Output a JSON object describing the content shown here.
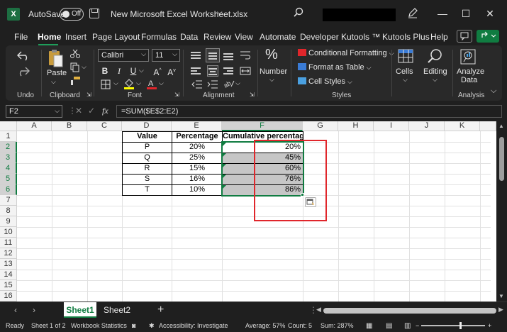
{
  "titlebar": {
    "app_icon": "X",
    "autosave_label": "AutoSave",
    "autosave_state": "Off",
    "document_title": "New Microsoft Excel Worksheet.xlsx",
    "icons": [
      "excel-logo-icon",
      "save-icon",
      "chevron-down-icon",
      "search-icon",
      "pen-icon",
      "minimize-icon",
      "maximize-icon",
      "close-icon"
    ]
  },
  "menu": {
    "tabs": [
      "File",
      "Home",
      "Insert",
      "Page Layout",
      "Formulas",
      "Data",
      "Review",
      "View",
      "Automate",
      "Developer",
      "Kutools ™",
      "Kutools Plus",
      "Help"
    ],
    "active": "Home"
  },
  "ribbon": {
    "undo_group": "Undo",
    "clipboard_group": "Clipboard",
    "paste_label": "Paste",
    "font_group": "Font",
    "font_name": "Calibri",
    "font_size": "11",
    "alignment_group": "Alignment",
    "number_label": "Number",
    "conditional_formatting": "Conditional Formatting",
    "format_as_table": "Format as Table",
    "cell_styles": "Cell Styles",
    "styles_group": "Styles",
    "cells_label": "Cells",
    "editing_label": "Editing",
    "analyze_label_1": "Analyze",
    "analyze_label_2": "Data",
    "analysis_group": "Analysis"
  },
  "formula_bar": {
    "name_box": "F2",
    "fx": "fx",
    "formula": "=SUM($E$2:E2)"
  },
  "grid": {
    "columns": [
      "A",
      "B",
      "C",
      "D",
      "E",
      "F",
      "G",
      "H",
      "I",
      "J",
      "K"
    ],
    "rows": [
      "1",
      "2",
      "3",
      "4",
      "5",
      "6",
      "7",
      "8",
      "9",
      "10",
      "11",
      "12",
      "13",
      "14",
      "15",
      "16"
    ],
    "headers": {
      "value": "Value",
      "percentage": "Percentage",
      "cumulative": "Cumulative percentage"
    },
    "data": [
      {
        "value": "P",
        "percentage": "20%",
        "cumulative": "20%"
      },
      {
        "value": "Q",
        "percentage": "25%",
        "cumulative": "45%"
      },
      {
        "value": "R",
        "percentage": "15%",
        "cumulative": "60%"
      },
      {
        "value": "S",
        "percentage": "16%",
        "cumulative": "76%"
      },
      {
        "value": "T",
        "percentage": "10%",
        "cumulative": "86%"
      }
    ],
    "selected_column": "F",
    "colors": {
      "selection": "#107c41",
      "highlight_box": "#e0262b"
    }
  },
  "sheets": {
    "tabs": [
      "Sheet1",
      "Sheet2"
    ],
    "active": "Sheet1"
  },
  "status": {
    "ready": "Ready",
    "sheet_of": "Sheet 1 of 2",
    "workbook_statistics": "Workbook Statistics",
    "accessibility": "Accessibility: Investigate",
    "average": "Average: 57%",
    "count": "Count: 5",
    "sum": "Sum: 287%"
  }
}
